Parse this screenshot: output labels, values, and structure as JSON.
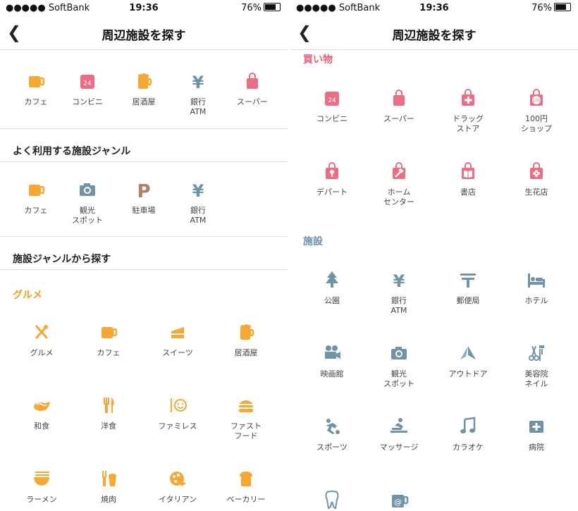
{
  "status": {
    "carrier": "●●●●● SoftBank",
    "time": "19:36",
    "battery": "76%"
  },
  "left": {
    "title": "周辺施設を探す",
    "quick": [
      {
        "label": "カフェ",
        "icon": "cafe"
      },
      {
        "label": "コンビニ",
        "icon": "conveni"
      },
      {
        "label": "居酒屋",
        "icon": "izakaya"
      },
      {
        "label": "銀行\nATM",
        "icon": "bank"
      },
      {
        "label": "スーパー",
        "icon": "super"
      }
    ],
    "frequent_title": "よく利用する施設ジャンル",
    "frequent": [
      {
        "label": "カフェ",
        "icon": "cafe"
      },
      {
        "label": "観光\nスポット",
        "icon": "camera"
      },
      {
        "label": "駐車場",
        "icon": "parking"
      },
      {
        "label": "銀行\nATM",
        "icon": "bank"
      }
    ],
    "genre_title": "施設ジャンルから探す",
    "gourmet_title": "グルメ",
    "gourmet": [
      {
        "label": "グルメ",
        "icon": "gourmet"
      },
      {
        "label": "カフェ",
        "icon": "cafe"
      },
      {
        "label": "スイーツ",
        "icon": "sweets"
      },
      {
        "label": "居酒屋",
        "icon": "izakaya"
      },
      {
        "label": "和食",
        "icon": "washoku"
      },
      {
        "label": "洋食",
        "icon": "yoshoku"
      },
      {
        "label": "ファミレス",
        "icon": "famires"
      },
      {
        "label": "ファスト\nフード",
        "icon": "burger"
      },
      {
        "label": "ラーメン",
        "icon": "ramen"
      },
      {
        "label": "焼肉",
        "icon": "yakiniku"
      },
      {
        "label": "イタリアン",
        "icon": "italian"
      },
      {
        "label": "ベーカリー",
        "icon": "bakery"
      }
    ]
  },
  "right": {
    "title": "周辺施設を探す",
    "shopping_title": "買い物",
    "shopping": [
      {
        "label": "コンビニ",
        "icon": "conveni"
      },
      {
        "label": "スーパー",
        "icon": "super"
      },
      {
        "label": "ドラッグ\nストア",
        "icon": "drug"
      },
      {
        "label": "100円\nショップ",
        "icon": "hundred"
      },
      {
        "label": "デパート",
        "icon": "depart"
      },
      {
        "label": "ホーム\nセンター",
        "icon": "homecenter"
      },
      {
        "label": "書店",
        "icon": "book"
      },
      {
        "label": "生花店",
        "icon": "flower"
      }
    ],
    "facility_title": "施設",
    "facility": [
      {
        "label": "公園",
        "icon": "park"
      },
      {
        "label": "銀行\nATM",
        "icon": "bank"
      },
      {
        "label": "郵便局",
        "icon": "post"
      },
      {
        "label": "ホテル",
        "icon": "hotel"
      },
      {
        "label": "映画館",
        "icon": "cinema"
      },
      {
        "label": "観光\nスポット",
        "icon": "camera"
      },
      {
        "label": "アウトドア",
        "icon": "outdoor"
      },
      {
        "label": "美容院\nネイル",
        "icon": "salon"
      },
      {
        "label": "スポーツ",
        "icon": "sports"
      },
      {
        "label": "マッサージ",
        "icon": "massage"
      },
      {
        "label": "カラオケ",
        "icon": "karaoke"
      },
      {
        "label": "病院",
        "icon": "hospital"
      },
      {
        "label": "",
        "icon": "dental"
      },
      {
        "label": "",
        "icon": "netcafe"
      }
    ]
  },
  "colors": {
    "orange": "#f5a832",
    "pink": "#ee6d82",
    "blue": "#6f93a8",
    "brown": "#b57a6a",
    "gourmet_title": "#f0a020",
    "shopping_title": "#e8607a",
    "facility_title": "#6f8fb0"
  }
}
